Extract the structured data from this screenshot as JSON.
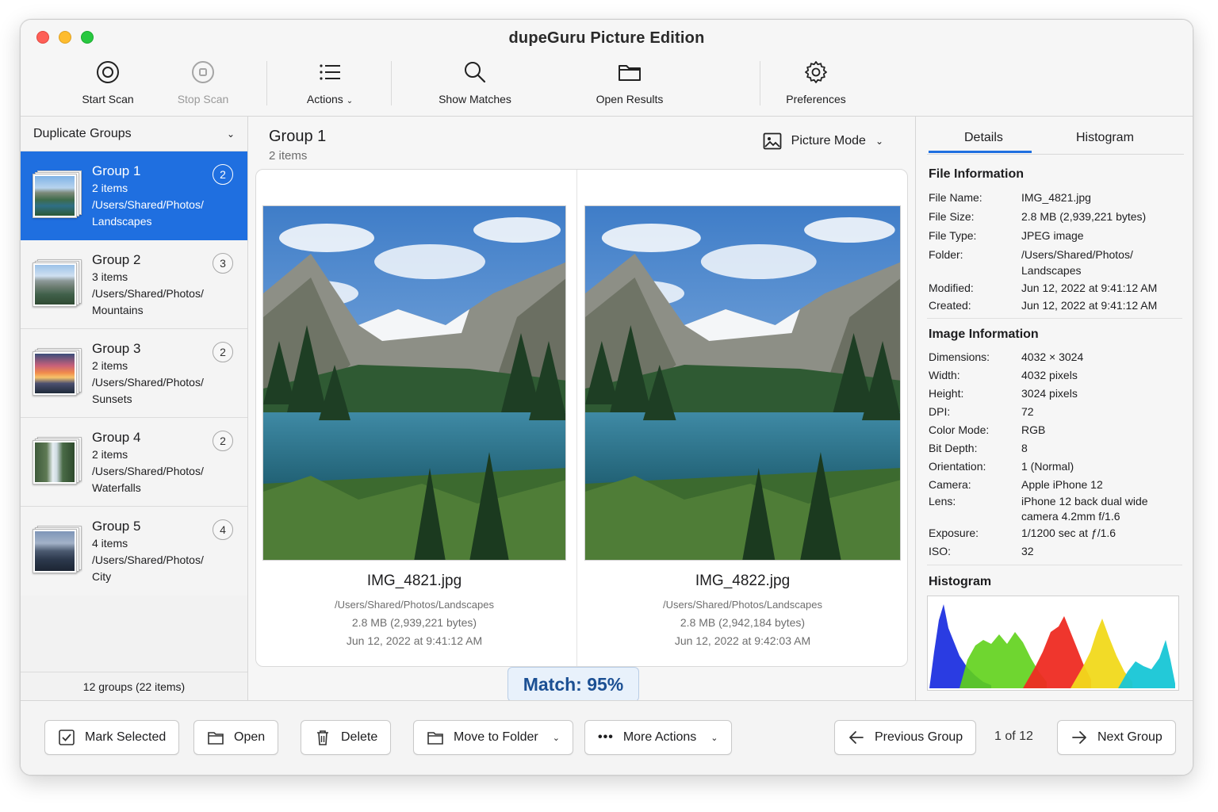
{
  "window": {
    "title": "dupeGuru Picture Edition"
  },
  "toolbar": {
    "start_scan": "Start Scan",
    "stop_scan": "Stop Scan",
    "actions": "Actions",
    "show_matches": "Show Matches",
    "open_results": "Open Results",
    "preferences": "Preferences"
  },
  "sidebar": {
    "header": "Duplicate Groups",
    "items": [
      {
        "title": "Group 1",
        "count": "2",
        "items": "2 items",
        "path1": "/Users/Shared/Photos/",
        "path2": "Landscapes"
      },
      {
        "title": "Group 2",
        "count": "3",
        "items": "3 items",
        "path1": "/Users/Shared/Photos/",
        "path2": "Mountains"
      },
      {
        "title": "Group 3",
        "count": "2",
        "items": "2 items",
        "path1": "/Users/Shared/Photos/",
        "path2": "Sunsets"
      },
      {
        "title": "Group 4",
        "count": "2",
        "items": "2 items",
        "path1": "/Users/Shared/Photos/",
        "path2": "Waterfalls"
      },
      {
        "title": "Group 5",
        "count": "4",
        "items": "4 items",
        "path1": "/Users/Shared/Photos/",
        "path2": "City"
      }
    ],
    "footer": "12 groups (22 items)"
  },
  "center": {
    "group_title": "Group 1",
    "group_sub": "2 items",
    "mode_label": "Picture Mode",
    "left": {
      "file": "IMG_4821.jpg",
      "path": "/Users/Shared/Photos/Landscapes",
      "size": "2.8 MB  (2,939,221 bytes)",
      "date": "Jun 12, 2022  at 9:41:12 AM"
    },
    "right": {
      "file": "IMG_4822.jpg",
      "path": "/Users/Shared/Photos/Landscapes",
      "size": "2.8 MB  (2,942,184 bytes)",
      "date": "Jun 12, 2022  at 9:42:03 AM"
    },
    "match": "Match: 95%"
  },
  "details": {
    "tab_details": "Details",
    "tab_histogram": "Histogram",
    "file_info_title": "File Information",
    "file_info": [
      {
        "k": "File Name:",
        "v": "IMG_4821.jpg"
      },
      {
        "k": "File Size:",
        "v": "2.8 MB (2,939,221 bytes)"
      },
      {
        "k": "File Type:",
        "v": "JPEG image"
      },
      {
        "k": "Folder:",
        "v": "/Users/Shared/Photos/",
        "v2": "Landscapes"
      },
      {
        "k": "Modified:",
        "v": "Jun 12, 2022 at 9:41:12 AM"
      },
      {
        "k": "Created:",
        "v": "Jun 12, 2022 at 9:41:12 AM"
      }
    ],
    "image_info_title": "Image Information",
    "image_info": [
      {
        "k": "Dimensions:",
        "v": "4032 × 3024"
      },
      {
        "k": "Width:",
        "v": "4032 pixels"
      },
      {
        "k": "Height:",
        "v": "3024 pixels"
      },
      {
        "k": "DPI:",
        "v": "72"
      },
      {
        "k": "Color Mode:",
        "v": "RGB"
      },
      {
        "k": "Bit Depth:",
        "v": "8"
      },
      {
        "k": "Orientation:",
        "v": "1 (Normal)"
      },
      {
        "k": "Camera:",
        "v": "Apple iPhone 12"
      },
      {
        "k": "Lens:",
        "v": "iPhone 12 back dual wide",
        "v2": "camera 4.2mm f/1.6"
      },
      {
        "k": "Exposure:",
        "v": "1/1200 sec at ƒ/1.6"
      },
      {
        "k": "ISO:",
        "v": "32"
      }
    ],
    "histogram_title": "Histogram"
  },
  "bottom": {
    "mark_selected": "Mark Selected",
    "open": "Open",
    "delete": "Delete",
    "move_to_folder": "Move to Folder",
    "more_actions": "More Actions",
    "previous_group": "Previous Group",
    "pager": "1  of 12",
    "next_group": "Next Group"
  },
  "colors": {
    "accent": "#1f6fe0",
    "match_text": "#1b4f93",
    "match_bg": "#e8f1fb"
  }
}
